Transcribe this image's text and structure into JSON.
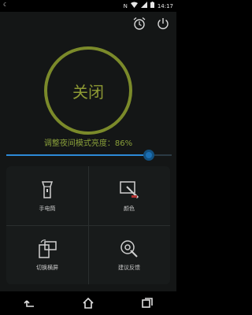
{
  "status": {
    "time": "14:17",
    "icons": [
      "moon-icon",
      "nfc-icon",
      "wifi-icon",
      "signal-icon",
      "battery-icon"
    ]
  },
  "top_actions": [
    "alarm-clock-icon",
    "power-icon"
  ],
  "main": {
    "toggle_label": "关闭",
    "brightness_label": "调整夜间模式亮度：86%",
    "brightness_value_percent": 86
  },
  "tools": [
    {
      "label": "手电筒",
      "icon": "flashlight-icon"
    },
    {
      "label": "颜色",
      "icon": "color-picker-icon"
    },
    {
      "label": "切换横屏",
      "icon": "rotate-screen-icon"
    },
    {
      "label": "建议反馈",
      "icon": "feedback-icon"
    }
  ],
  "nav": [
    "back-icon",
    "home-icon",
    "recents-icon"
  ],
  "colors": {
    "ring": "#7b8a2a",
    "accent_text": "#8aa03a",
    "slider_fill": "#2d8ad7"
  }
}
